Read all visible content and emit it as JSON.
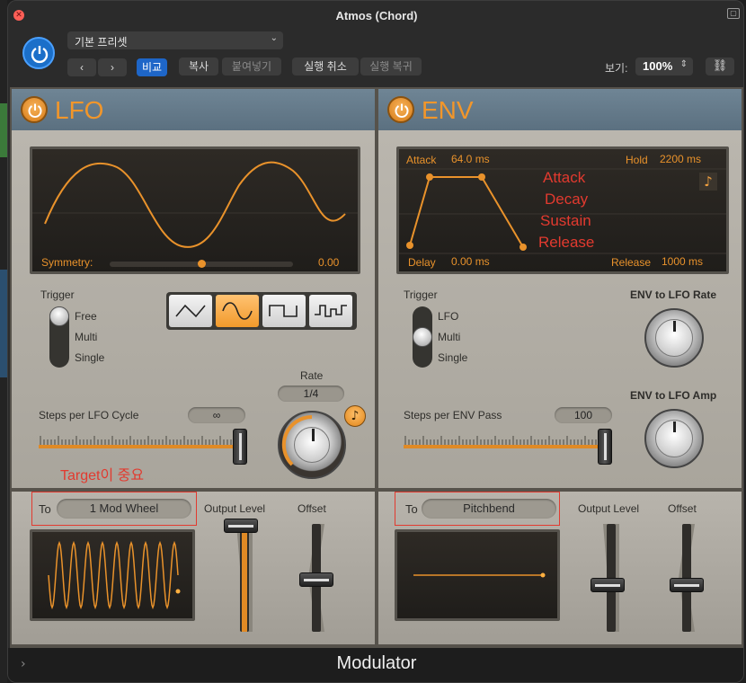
{
  "window": {
    "title": "Atmos (Chord)"
  },
  "toolbar": {
    "preset": "기본 프리셋",
    "prev": "‹",
    "next": "›",
    "compare": "비교",
    "copy": "복사",
    "paste": "붙여넣기",
    "undo": "실행 취소",
    "redo": "실행 복귀",
    "view_label": "보기:",
    "zoom": "100%",
    "zoom_arrows": "⌃⌄"
  },
  "lfo": {
    "title": "LFO",
    "symmetry_label": "Symmetry:",
    "symmetry_value": "0.00",
    "symmetry_level": 0.5,
    "trigger_label": "Trigger",
    "trigger_options": [
      "Free",
      "Multi",
      "Single"
    ],
    "trigger_selected": "Free",
    "waveforms": [
      "triangle",
      "sine",
      "square",
      "random"
    ],
    "waveform_selected": "sine",
    "rate_label": "Rate",
    "rate_value": "1/4",
    "steps_label": "Steps per LFO Cycle",
    "steps_value": "∞",
    "steps_level": 1.0,
    "note_icon": "♪",
    "annotation": "Target이 중요"
  },
  "env": {
    "title": "ENV",
    "attack_label": "Attack",
    "attack_value": "64.0 ms",
    "hold_label": "Hold",
    "hold_value": "2200 ms",
    "delay_label": "Delay",
    "delay_value": "0.00 ms",
    "release_label": "Release",
    "release_value": "1000 ms",
    "annotations": [
      "Attack",
      "Decay",
      "Sustain",
      "Release"
    ],
    "note_icon": "♪",
    "trigger_label": "Trigger",
    "trigger_options": [
      "LFO",
      "Multi",
      "Single"
    ],
    "trigger_selected": "Multi",
    "steps_label": "Steps per ENV Pass",
    "steps_value": "100",
    "steps_level": 1.0,
    "rate_knob_label": "ENV to LFO Rate",
    "amp_knob_label": "ENV to LFO Amp"
  },
  "lfo_out": {
    "to_label": "To",
    "target": "1 Mod Wheel",
    "output_label": "Output Level",
    "output_level": 1.0,
    "offset_label": "Offset",
    "offset_level": 0.5
  },
  "env_out": {
    "to_label": "To",
    "target": "Pitchbend",
    "output_label": "Output Level",
    "output_level": 0.5,
    "offset_label": "Offset",
    "offset_level": 0.5
  },
  "footer": {
    "plugin_name": "Modulator",
    "expand_icon": "›"
  },
  "colors": {
    "accent": "#e9922b",
    "annotation": "#e23a2f",
    "power": "#1b6fc9"
  }
}
